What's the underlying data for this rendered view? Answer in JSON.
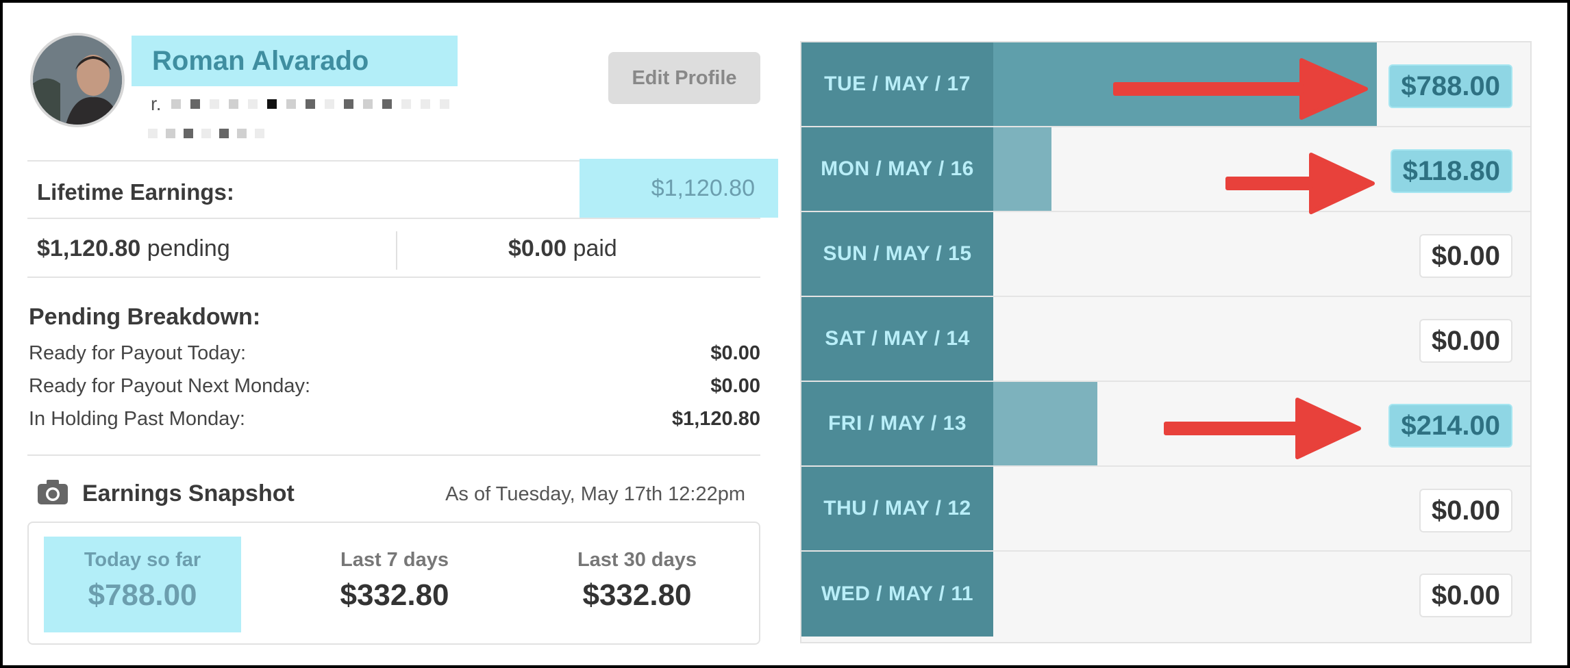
{
  "profile": {
    "name": "Roman Alvarado",
    "email_prefix": "r.",
    "edit_button": "Edit Profile"
  },
  "lifetime": {
    "label": "Lifetime Earnings:",
    "value": "$1,120.80",
    "pending_amount": "$1,120.80",
    "pending_word": "pending",
    "paid_amount": "$0.00",
    "paid_word": "paid"
  },
  "breakdown": {
    "title": "Pending Breakdown:",
    "rows": [
      {
        "label": "Ready for Payout Today:",
        "value": "$0.00"
      },
      {
        "label": "Ready for Payout Next Monday:",
        "value": "$0.00"
      },
      {
        "label": "In Holding Past Monday:",
        "value": "$1,120.80"
      }
    ]
  },
  "snapshot": {
    "icon": "camera-icon",
    "title": "Earnings Snapshot",
    "as_of": "As of Tuesday, May 17th 12:22pm",
    "cells": [
      {
        "label": "Today so far",
        "value": "$788.00"
      },
      {
        "label": "Last 7 days",
        "value": "$332.80"
      },
      {
        "label": "Last 30 days",
        "value": "$332.80"
      }
    ]
  },
  "daily": [
    {
      "date": "TUE / MAY / 17",
      "amount": "$788.00",
      "fraction": 1.0,
      "highlighted": true
    },
    {
      "date": "MON / MAY / 16",
      "amount": "$118.80",
      "fraction": 0.151,
      "highlighted": true
    },
    {
      "date": "SUN / MAY / 15",
      "amount": "$0.00",
      "fraction": 0,
      "highlighted": false
    },
    {
      "date": "SAT / MAY / 14",
      "amount": "$0.00",
      "fraction": 0,
      "highlighted": false
    },
    {
      "date": "FRI / MAY / 13",
      "amount": "$214.00",
      "fraction": 0.272,
      "highlighted": true
    },
    {
      "date": "THU / MAY / 12",
      "amount": "$0.00",
      "fraction": 0,
      "highlighted": false
    },
    {
      "date": "WED / MAY / 11",
      "amount": "$0.00",
      "fraction": 0,
      "highlighted": false
    }
  ],
  "colors": {
    "highlight": "#b3eef8",
    "bar": "#5f9fab",
    "date_label_bg": "#4d8b97",
    "arrow": "#e8413b"
  }
}
